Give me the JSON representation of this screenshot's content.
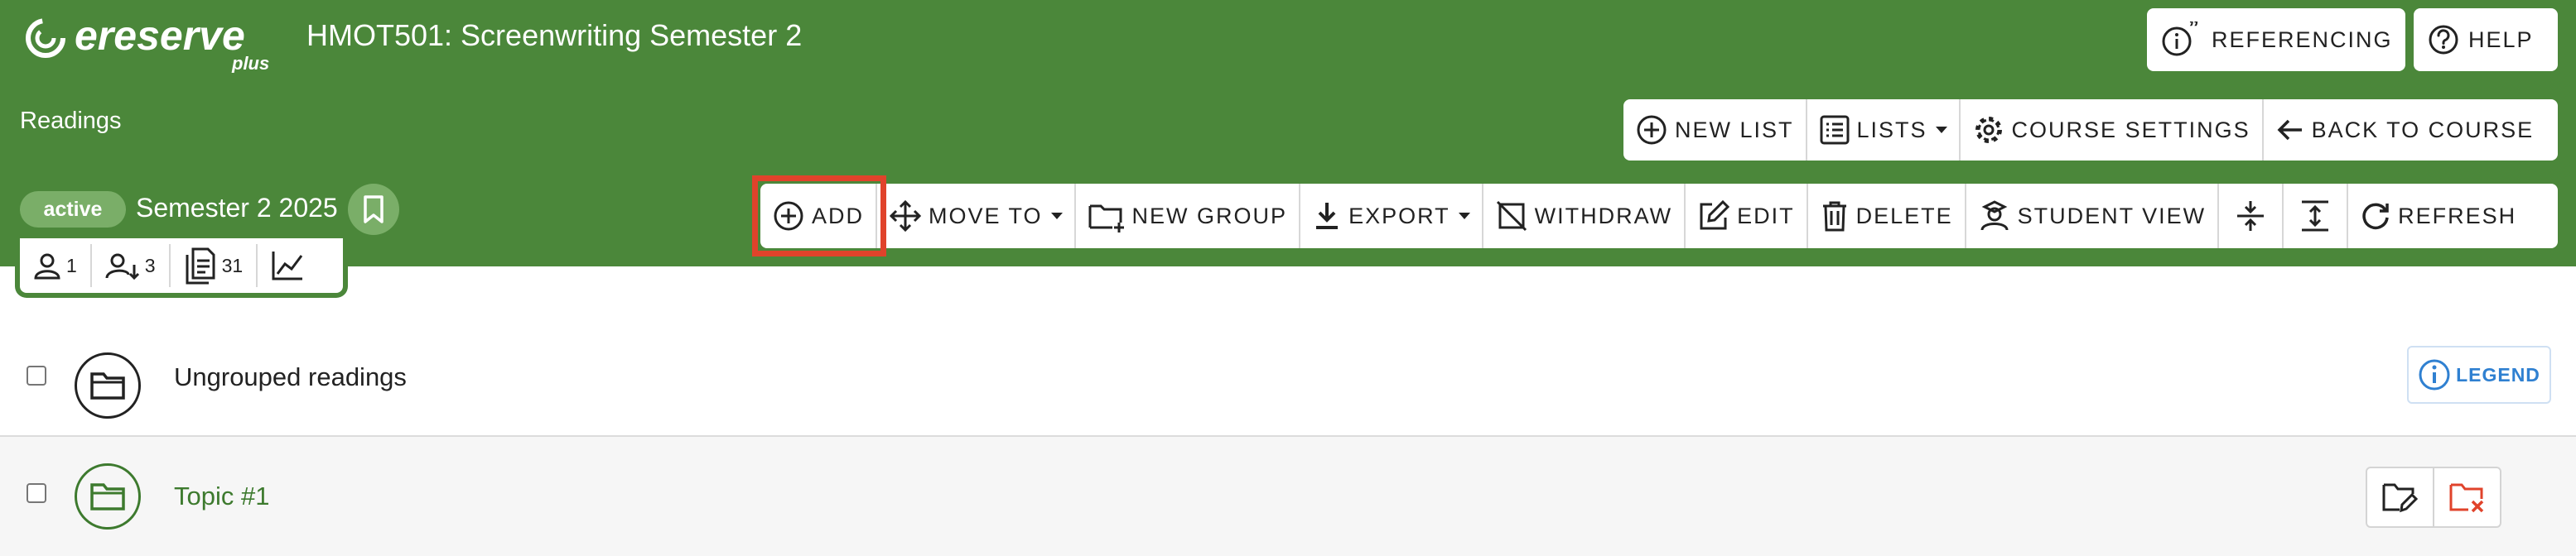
{
  "app": {
    "logo_text": "ereserve",
    "logo_sub": "plus",
    "course_title": "HMOT501: Screenwriting Semester 2",
    "section_title": "Readings"
  },
  "top_buttons": {
    "referencing": "REFERENCING",
    "help": "HELP"
  },
  "list_toolbar": {
    "new_list": "NEW LIST",
    "lists": "LISTS",
    "course_settings": "COURSE SETTINGS",
    "back_to_course": "BACK TO COURSE"
  },
  "status": {
    "badge": "active",
    "semester": "Semester 2 2025"
  },
  "stats": {
    "users": "1",
    "sorted_users": "3",
    "documents": "31"
  },
  "main_toolbar": {
    "add": "ADD",
    "move_to": "MOVE TO",
    "new_group": "NEW GROUP",
    "export": "EXPORT",
    "withdraw": "WITHDRAW",
    "edit": "EDIT",
    "delete": "DELETE",
    "student_view": "STUDENT VIEW",
    "refresh": "REFRESH"
  },
  "rows": [
    {
      "label": "Ungrouped readings"
    },
    {
      "label": "Topic #1"
    }
  ],
  "legend": {
    "label": "LEGEND"
  },
  "colors": {
    "brand_green": "#4b873a",
    "pill_green": "#7aae68",
    "highlight_red": "#e0432b",
    "legend_blue": "#2f80d1",
    "topic_green": "#3d7a2e"
  }
}
